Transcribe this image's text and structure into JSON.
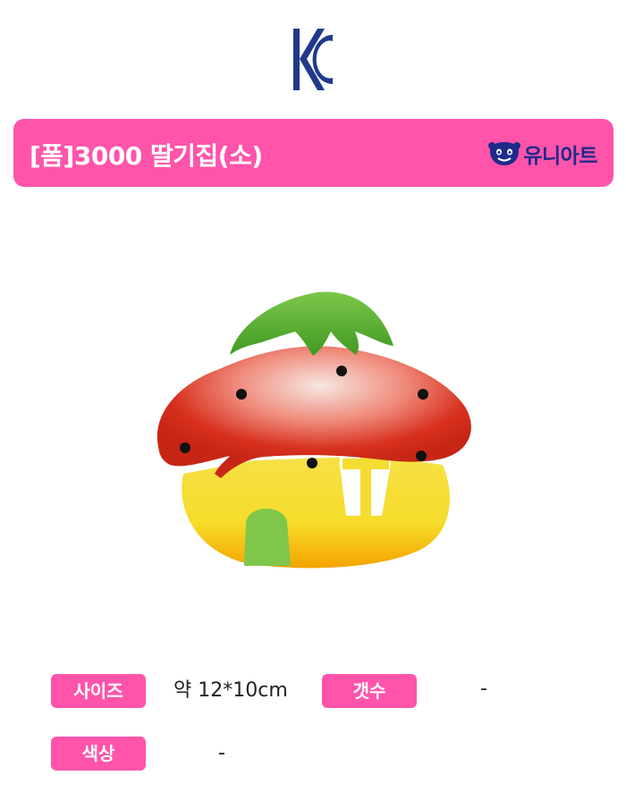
{
  "certification": {
    "mark": "KC",
    "icon": "kc-certification-icon"
  },
  "header": {
    "title": "[폼]3000 딸기집(소)",
    "brand": "유니아트",
    "brand_icon": "smiley-character-icon",
    "background_color": "#ff54aa",
    "brand_color": "#1f2a8a"
  },
  "product": {
    "image": "strawberry-house-foam-craft"
  },
  "specs": {
    "size_label": "사이즈",
    "size_value": "약 12*10cm",
    "count_label": "갯수",
    "count_value": "-",
    "color_label": "색상",
    "color_value": "-"
  }
}
